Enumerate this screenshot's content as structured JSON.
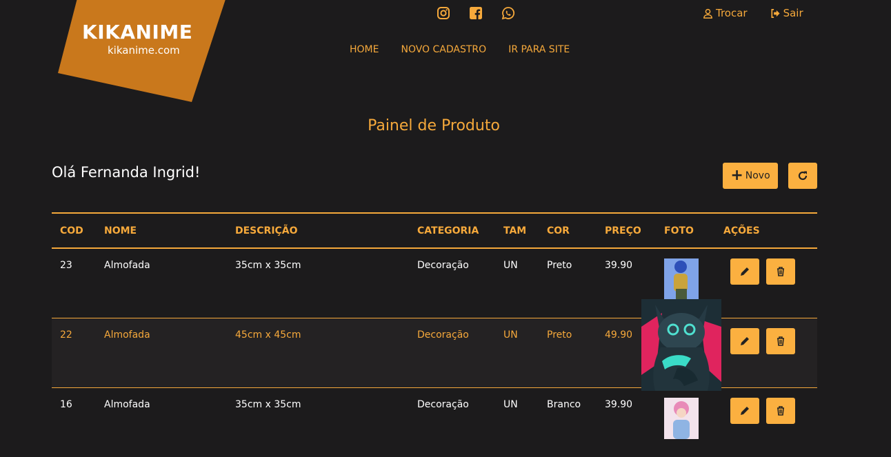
{
  "logo": {
    "line1": "KIKANIME",
    "line2": "kikanime.com"
  },
  "social": [
    {
      "icon": "instagram-icon"
    },
    {
      "icon": "facebook-icon"
    },
    {
      "icon": "whatsapp-icon"
    }
  ],
  "user_links": {
    "switch": "Trocar",
    "logout": "Sair"
  },
  "nav": [
    "HOME",
    "NOVO CADASTRO",
    "IR PARA SITE"
  ],
  "page_title": "Painel de Produto",
  "greeting": "Olá Fernanda Ingrid!",
  "buttons": {
    "new": "Novo"
  },
  "colors": {
    "accent": "#f6a93b",
    "button": "#fbb040",
    "background": "#1c1b1c"
  },
  "table": {
    "headers": [
      "COD",
      "NOME",
      "DESCRIÇÃO",
      "CATEGORIA",
      "TAM",
      "COR",
      "PREÇO",
      "FOTO",
      "AÇÕES"
    ],
    "rows": [
      [
        "23",
        "Almofada",
        "35cm x 35cm",
        "Decoração",
        "UN",
        "Preto",
        "39.90"
      ],
      [
        "22",
        "Almofada",
        "45cm x 45cm",
        "Decoração",
        "UN",
        "Preto",
        "49.90"
      ],
      [
        "16",
        "Almofada",
        "35cm x 35cm",
        "Decoração",
        "UN",
        "Branco",
        "39.90"
      ]
    ]
  }
}
